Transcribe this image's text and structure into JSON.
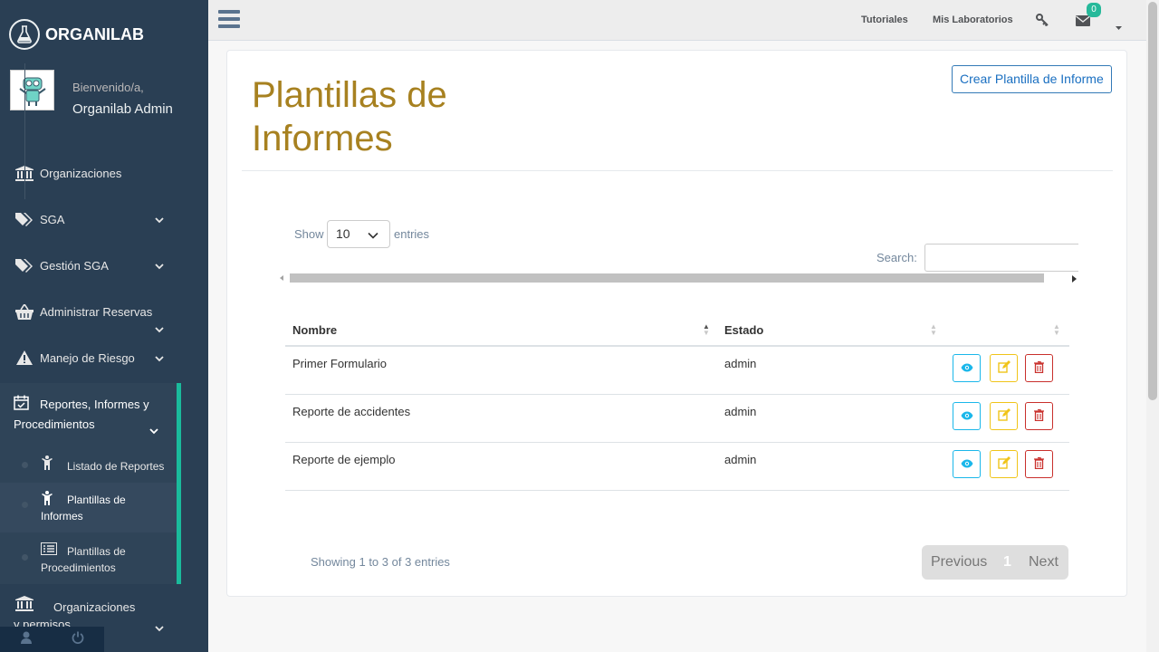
{
  "app": {
    "name": "ORGANILAB"
  },
  "profile": {
    "welcome": "Bienvenido/a,",
    "name": "Organilab Admin"
  },
  "sidebar": {
    "items": [
      {
        "label": "Organizaciones",
        "icon": "bank-icon"
      },
      {
        "label": "SGA",
        "icon": "tags-icon"
      },
      {
        "label": "Gestión SGA",
        "icon": "tags-icon"
      },
      {
        "label": "Administrar Reservas",
        "icon": "basket-icon"
      },
      {
        "label": "Manejo de Riesgo",
        "icon": "warning-icon"
      },
      {
        "label": "Reportes, Informes y Procedimientos",
        "icon": "calendar-check-icon"
      },
      {
        "label": "Organizaciones y permisos",
        "icon": "bank-icon"
      }
    ],
    "subitems": [
      {
        "label": "Listado de Reportes",
        "icon": "person-icon"
      },
      {
        "label": "Plantillas de Informes",
        "icon": "person-icon"
      },
      {
        "label": "Plantillas de Procedimientos",
        "icon": "list-icon"
      }
    ]
  },
  "topnav": {
    "tutoriales": "Tutoriales",
    "mis_laboratorios": "Mis Laboratorios",
    "messages_count": "0"
  },
  "page": {
    "title": "Plantillas de Informes",
    "create_button": "Crear Plantilla de Informe",
    "show_label": "Show",
    "entries_label": "entries",
    "page_length": "10",
    "search_label": "Search:",
    "search_value": "",
    "info": "Showing 1 to 3 of 3 entries",
    "pagination": {
      "previous": "Previous",
      "current": "1",
      "next": "Next"
    }
  },
  "table": {
    "columns": [
      "Nombre",
      "Estado",
      ""
    ],
    "rows": [
      {
        "nombre": "Primer Formulario",
        "estado": "admin"
      },
      {
        "nombre": "Reporte de accidentes",
        "estado": "admin"
      },
      {
        "nombre": "Reporte de ejemplo",
        "estado": "admin"
      }
    ]
  },
  "colors": {
    "sidebar": "#2a3f54",
    "accent": "#1abb9c",
    "title": "#a78120",
    "view": "#1ab7ea",
    "edit": "#f0c419",
    "delete": "#c9302c"
  }
}
